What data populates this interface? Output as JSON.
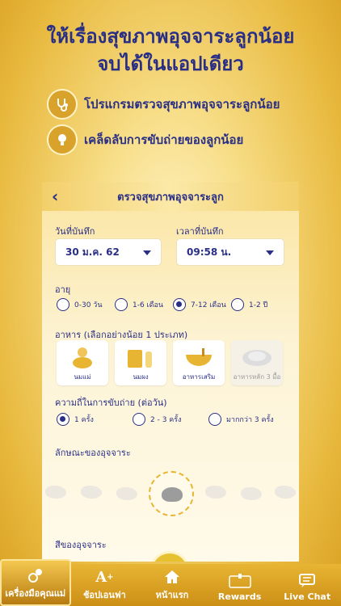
{
  "promo": {
    "title_line1": "ให้เรื่องสุขภาพอุจจาระลูกน้อย",
    "title_line2": "จบได้ในแอปเดียว",
    "features": [
      {
        "label": "โปรแกรมตรวจสุขภาพอุจจาระลูกน้อย",
        "icon": "stethoscope-icon"
      },
      {
        "label": "เคล็ดลับการขับถ่ายของลูกน้อย",
        "icon": "lightbulb-icon"
      }
    ]
  },
  "screen": {
    "back": "‹",
    "title": "ตรวจสุขภาพอุจจาระลูก",
    "date_label": "วันที่บันทึก",
    "date_value": "30 ม.ค. 62",
    "time_label": "เวลาที่บันทึก",
    "time_value": "09:58 น.",
    "age_label": "อายุ",
    "age_options": [
      "0-30 วัน",
      "1-6 เดือน",
      "7-12 เดือน",
      "1-2 ปี"
    ],
    "age_selected": "7-12 เดือน",
    "food_label": "อาหาร (เลือกอย่างน้อย 1 ประเภท)",
    "food_options": [
      "นมแม่",
      "นมผง",
      "อาหารเสริม",
      "อาหารหลัก 3 มื้อ"
    ],
    "freq_label": "ความถี่ในการขับถ่าย (ต่อวัน)",
    "freq_options": [
      "1 ครั้ง",
      "2 - 3 ครั้ง",
      "มากกว่า 3 ครั้ง"
    ],
    "freq_selected": "1 ครั้ง",
    "shape_label": "ลักษณะของอุจจาระ",
    "color_label": "สีของอุจจาระ"
  },
  "colors": {
    "brand_navy": "#2a2f86",
    "gold": "#e8b533",
    "stool_swatches": [
      "#c98a1c",
      "#3f5a1a",
      "#9a9a9a",
      "#e6c233",
      "#5a1111",
      "#2b2b2b"
    ]
  },
  "tabbar": {
    "items": [
      {
        "label": "เครื่องมือคุณแม่",
        "icon": "pacifier-icon",
        "active": true
      },
      {
        "label": "ช้อปเอนฟา",
        "icon": "a-plus-icon",
        "active": false
      },
      {
        "label": "หน้าแรก",
        "icon": "home-icon",
        "active": false
      },
      {
        "label": "Rewards",
        "icon": "rewards-icon",
        "active": false
      },
      {
        "label": "Live Chat",
        "icon": "chat-icon",
        "active": false
      }
    ]
  }
}
